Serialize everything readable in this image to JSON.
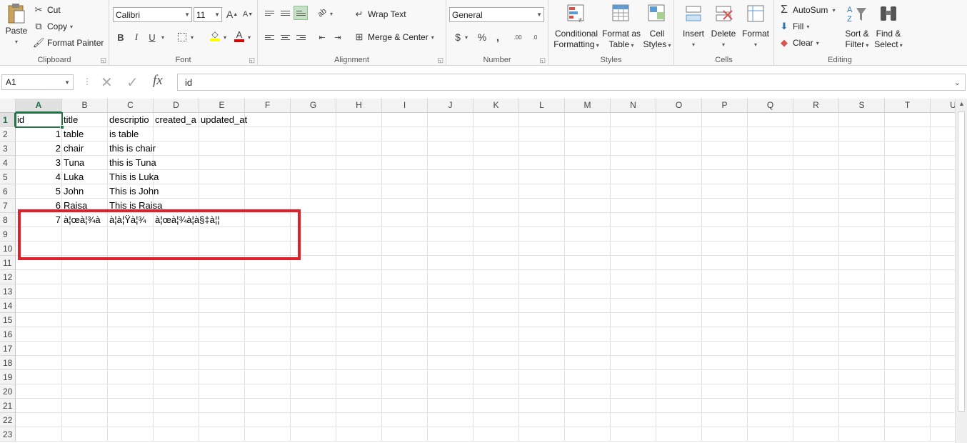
{
  "ribbon": {
    "clipboard": {
      "group_label": "Clipboard",
      "paste": "Paste",
      "cut": "Cut",
      "copy": "Copy",
      "format_painter": "Format Painter"
    },
    "font": {
      "group_label": "Font",
      "font_name": "Calibri",
      "font_size": "11",
      "bold": "B",
      "italic": "I",
      "underline": "U",
      "grow": "A",
      "shrink": "A",
      "font_color_glyph": "A"
    },
    "alignment": {
      "group_label": "Alignment",
      "wrap_text": "Wrap Text",
      "merge_center": "Merge & Center"
    },
    "number": {
      "group_label": "Number",
      "format": "General",
      "currency": "$",
      "percent": "%",
      "comma": ",",
      "inc_decimal": ".00",
      "dec_decimal": ".0"
    },
    "styles": {
      "group_label": "Styles",
      "conditional_1": "Conditional",
      "conditional_2": "Formatting",
      "format_table_1": "Format as",
      "format_table_2": "Table",
      "cell_styles_1": "Cell",
      "cell_styles_2": "Styles"
    },
    "cells": {
      "group_label": "Cells",
      "insert": "Insert",
      "delete": "Delete",
      "format": "Format"
    },
    "editing": {
      "group_label": "Editing",
      "autosum": "AutoSum",
      "fill": "Fill",
      "clear": "Clear",
      "sort_1": "Sort &",
      "sort_2": "Filter",
      "find_1": "Find &",
      "find_2": "Select"
    }
  },
  "formula_bar": {
    "name_box": "A1",
    "fx": "fx",
    "content": "id"
  },
  "grid": {
    "columns": [
      "A",
      "B",
      "C",
      "D",
      "E",
      "F",
      "G",
      "H",
      "I",
      "J",
      "K",
      "L",
      "M",
      "N",
      "O",
      "P",
      "Q",
      "R",
      "S",
      "T",
      "U"
    ],
    "selected_column": "A",
    "rows": [
      "1",
      "2",
      "3",
      "4",
      "5",
      "6",
      "7",
      "8",
      "9",
      "10",
      "11",
      "12",
      "13",
      "14",
      "15",
      "16",
      "17",
      "18",
      "19",
      "20",
      "21",
      "22",
      "23"
    ],
    "selected_row": "1",
    "cells": {
      "r1": {
        "a": "id",
        "b": "title",
        "c": "descriptio",
        "d": "created_a",
        "e": "updated_at"
      },
      "r2": {
        "a": "1",
        "b": "table",
        "c": "is table"
      },
      "r3": {
        "a": "2",
        "b": "chair",
        "c": "this is chair"
      },
      "r4": {
        "a": "3",
        "b": "Tuna",
        "c": "this is Tuna"
      },
      "r5": {
        "a": "4",
        "b": "Luka",
        "c": "This is Luka"
      },
      "r6": {
        "a": "5",
        "b": "John",
        "c": "This is John"
      },
      "r7": {
        "a": "6",
        "b": "Raisa",
        "c": "This is Raisa"
      },
      "r8": {
        "a": "7",
        "b": "à¦œà¦¾à",
        "c": "à¦à¦Ÿà¦¾",
        "d": "à¦œà¦¾à¦­à§‡à¦¦"
      }
    }
  },
  "colors": {
    "accent": "#217346",
    "highlight_box": "#e0202a",
    "header_bg": "#f3f3f3"
  }
}
